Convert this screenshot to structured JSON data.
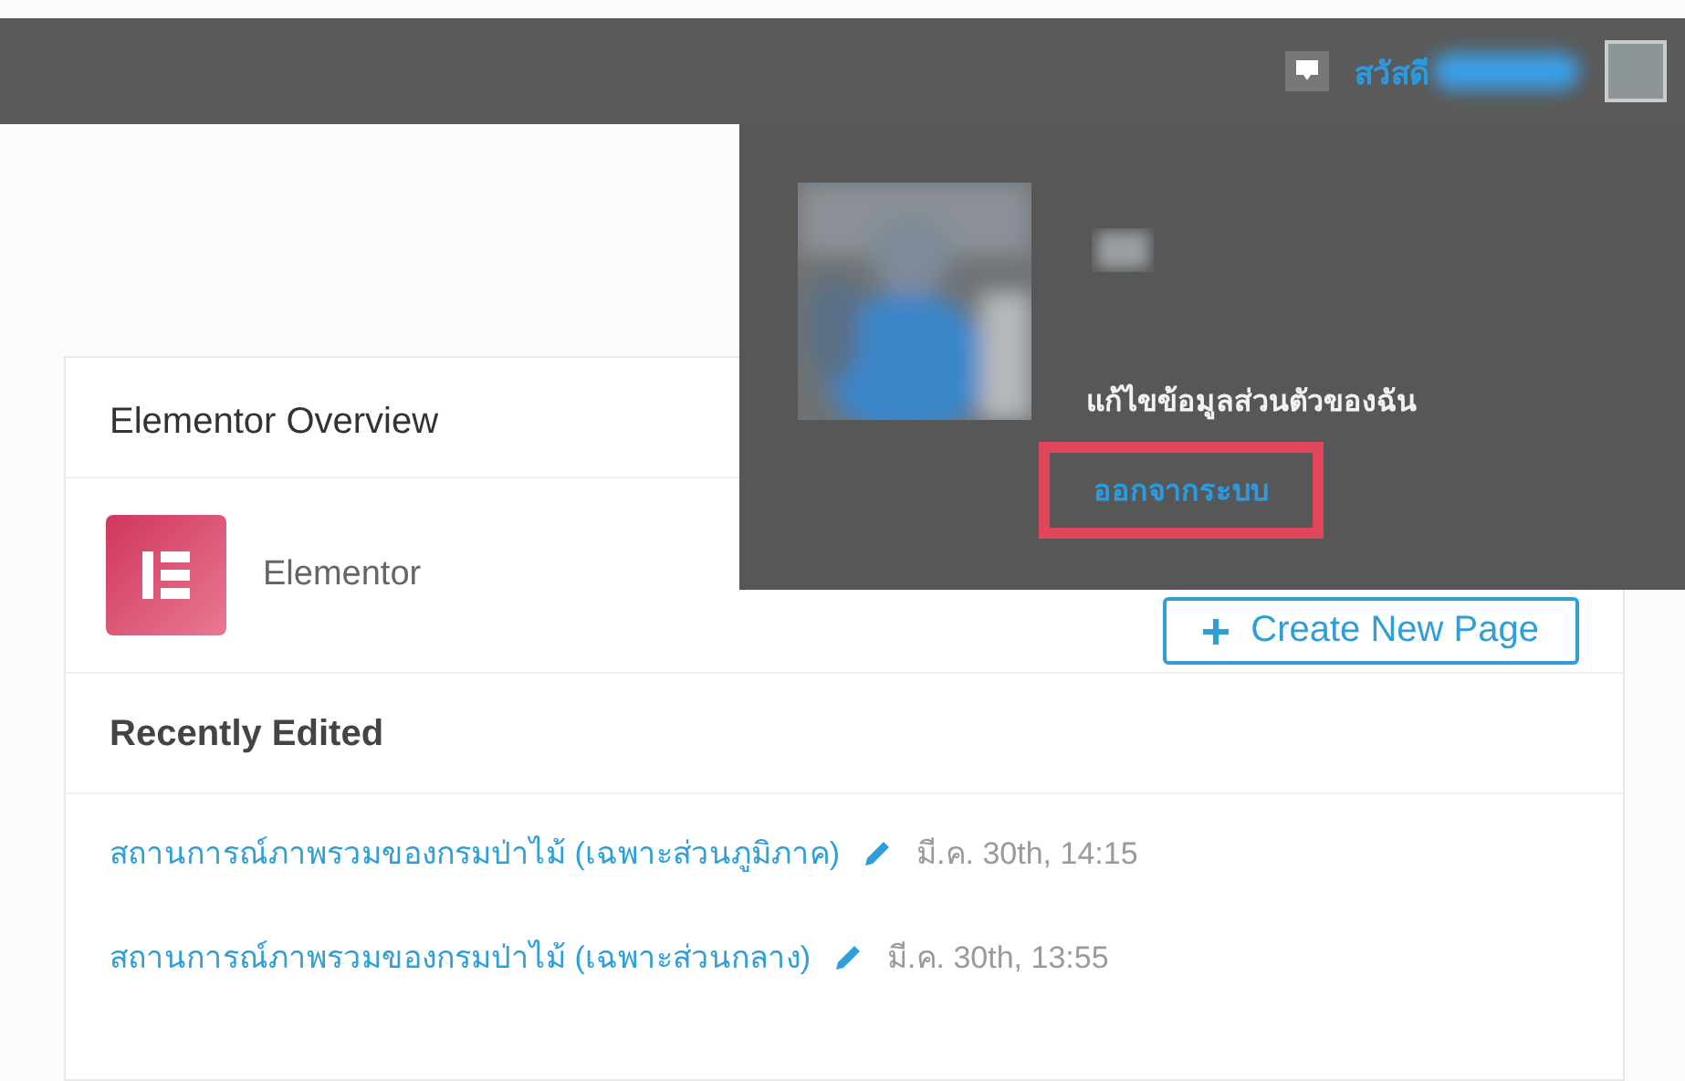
{
  "top_bar": {
    "greeting": "สวัสดี"
  },
  "user_menu": {
    "edit_profile": "แก้ไขข้อมูลส่วนตัวของฉัน",
    "logout": "ออกจากระบบ"
  },
  "overview": {
    "title": "Elementor Overview",
    "product": "Elementor",
    "create_button": "Create New Page",
    "recent_title": "Recently Edited",
    "recent": [
      {
        "title": "สถานการณ์ภาพรวมของกรมป่าไม้ (เฉพาะส่วนภูมิภาค)",
        "date": "มี.ค. 30th, 14:15"
      },
      {
        "title": "สถานการณ์ภาพรวมของกรมป่าไม้ (เฉพาะส่วนกลาง)",
        "date": "มี.ค. 30th, 13:55"
      }
    ]
  }
}
